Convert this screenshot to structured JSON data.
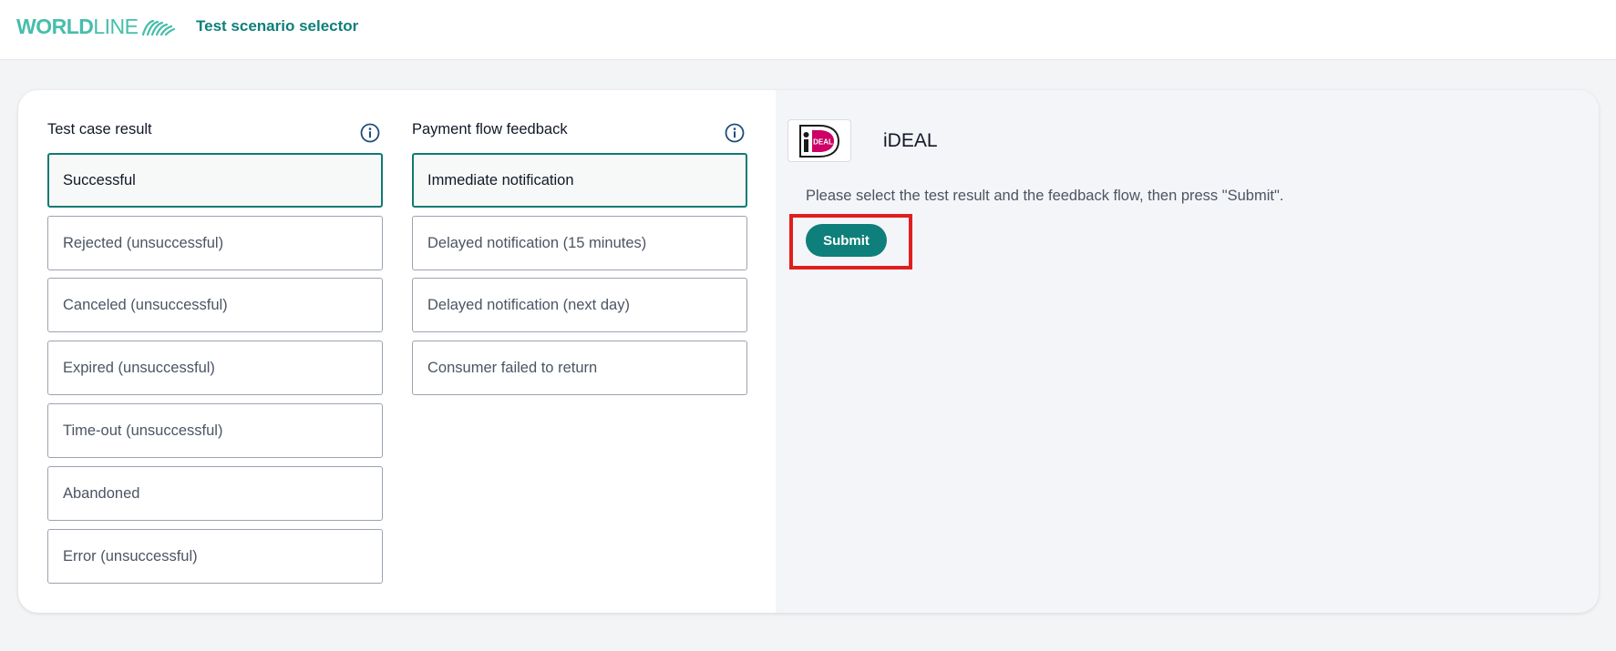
{
  "header": {
    "logo_bold": "WORLD",
    "logo_light": "LINE",
    "title": "Test scenario selector"
  },
  "test_case": {
    "title": "Test case result",
    "options": [
      "Successful",
      "Rejected (unsuccessful)",
      "Canceled (unsuccessful)",
      "Expired (unsuccessful)",
      "Time-out (unsuccessful)",
      "Abandoned",
      "Error (unsuccessful)"
    ],
    "selected": "Successful"
  },
  "payment_flow": {
    "title": "Payment flow feedback",
    "options": [
      "Immediate notification",
      "Delayed notification (15 minutes)",
      "Delayed notification (next day)",
      "Consumer failed to return"
    ],
    "selected": "Immediate notification"
  },
  "payment_method": {
    "name": "iDEAL",
    "logo_text": "DEAL",
    "instructions": "Please select the test result and the feedback flow, then press \"Submit\".",
    "submit_label": "Submit"
  },
  "colors": {
    "brand": "#46beaa",
    "primary": "#0e7f7a",
    "highlight": "#e01e1e",
    "ideal_pink": "#cc0066"
  },
  "icons": [
    "info-icon",
    "ideal-logo",
    "worldline-logo"
  ]
}
